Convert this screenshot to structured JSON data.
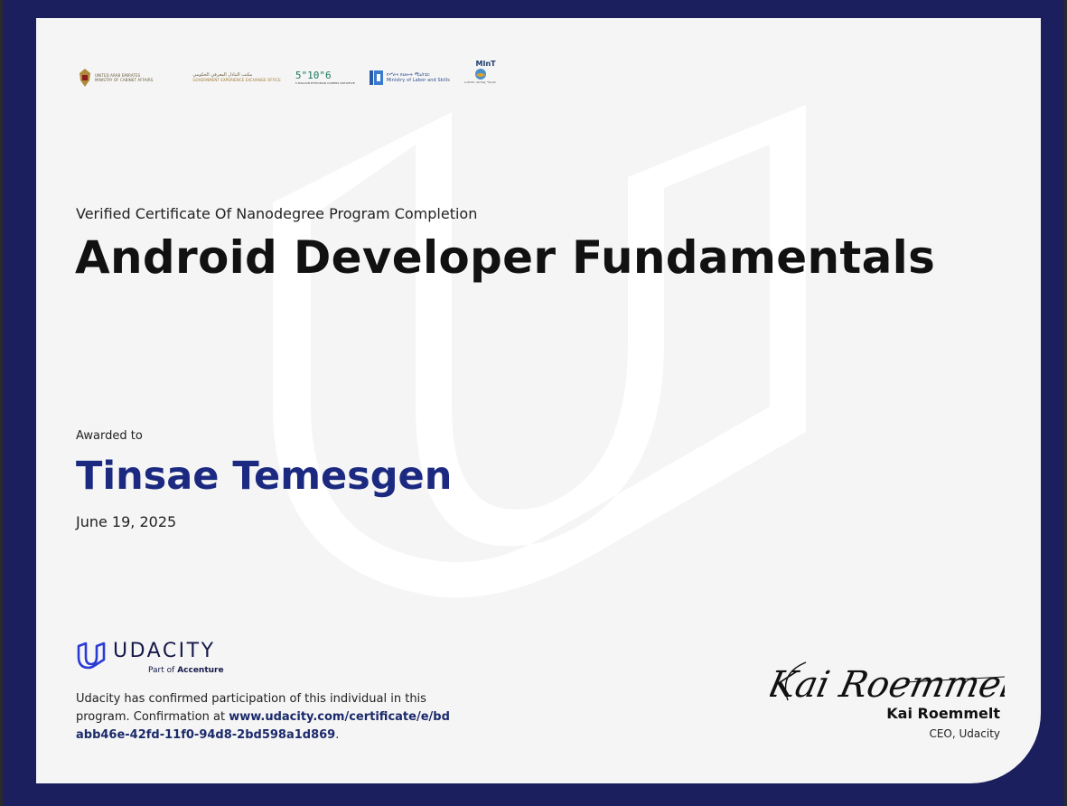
{
  "certificate": {
    "subtitle": "Verified Certificate Of Nanodegree Program Completion",
    "program_title": "Android Developer Fundamentals",
    "awarded_label": "Awarded to",
    "recipient_name": "Tinsae Temesgen",
    "date": "June 19, 2025"
  },
  "logos": {
    "uae_cabinet_line1": "UNITED ARAB EMIRATES",
    "uae_cabinet_line2": "MINISTRY OF CABINET AFFAIRS",
    "gov_exchange_arabic": "مكتب التبادل المعرفي الحكومي",
    "gov_exchange_english": "GOVERNMENT EXPERIENCE EXCHANGE OFFICE",
    "coders_label": "5\"10\"6",
    "coders_caption": "5 MILLION ETHIOPIAN CODERS INITIATIVE",
    "labor_amharic": "የሥራና ክህሎት ሚኒስቴር",
    "labor_english": "Ministry of Labor and Skills",
    "mint_label": "MInT",
    "mint_caption": "ኢኖቬሽንና ቴክኖሎጂ ሚኒስቴር"
  },
  "brand": {
    "wordmark": "UDACITY",
    "tagline_prefix": "Part of",
    "tagline_company": "Accenture",
    "confirmation_text": "Udacity has confirmed participation of this individual in this program. Confirmation at",
    "confirmation_link": "www.udacity.com/certificate/e/bdabb46e-42fd-11f0-94d8-2bd598a1d869",
    "confirmation_end": "."
  },
  "signer": {
    "signature": "Kai Roemmelt",
    "name": "Kai Roemmelt",
    "role": "CEO, Udacity"
  },
  "colors": {
    "frame": "#1b1f5e",
    "paper": "#f5f5f5",
    "recipient": "#1b2a80",
    "brand_blue": "#2b3bd6"
  }
}
